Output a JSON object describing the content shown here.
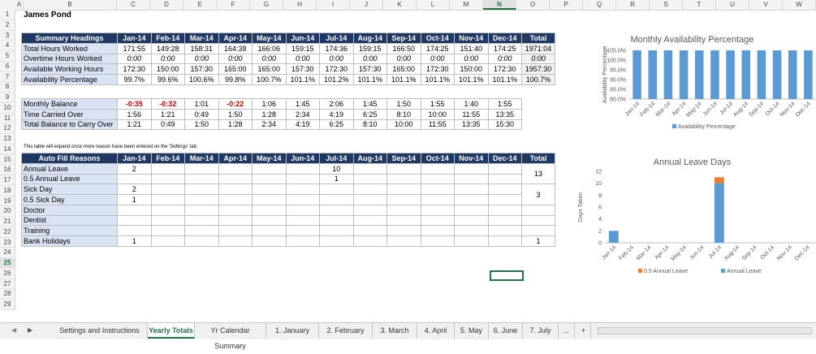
{
  "column_headers": [
    "A",
    "B",
    "C",
    "D",
    "E",
    "F",
    "G",
    "H",
    "I",
    "J",
    "K",
    "L",
    "M",
    "N",
    "O",
    "P",
    "Q",
    "R",
    "S",
    "T",
    "U",
    "V",
    "W"
  ],
  "selected_column": "N",
  "row_numbers": [
    "1",
    "2",
    "3",
    "4",
    "5",
    "6",
    "7",
    "8",
    "9",
    "10",
    "11",
    "12",
    "13",
    "14",
    "15",
    "16",
    "17",
    "18",
    "19",
    "20",
    "21",
    "22",
    "23",
    "24",
    "25",
    "26",
    "27",
    "28",
    "29"
  ],
  "selected_row": "25",
  "sheet_title": "James Pond",
  "months": [
    "Jan-14",
    "Feb-14",
    "Mar-14",
    "Apr-14",
    "May-14",
    "Jun-14",
    "Jul-14",
    "Aug-14",
    "Sep-14",
    "Oct-14",
    "Nov-14",
    "Dec-14"
  ],
  "summary": {
    "header": "Summary Headings",
    "total_label": "Total",
    "rows": [
      {
        "label": "Total Hours Worked",
        "values": [
          "171:55",
          "149:28",
          "158:31",
          "164:38",
          "166:06",
          "159:15",
          "174:36",
          "159:15",
          "166:50",
          "174:25",
          "151:40",
          "174:25"
        ],
        "total": "1971:04"
      },
      {
        "label": "Overtime Hours Worked",
        "values": [
          "0:00",
          "0:00",
          "0:00",
          "0:00",
          "0:00",
          "0:00",
          "0:00",
          "0:00",
          "0:00",
          "0:00",
          "0:00",
          "0:00"
        ],
        "total": "0:00"
      },
      {
        "label": "Available Working Hours",
        "values": [
          "172:30",
          "150:00",
          "157:30",
          "165:00",
          "165:00",
          "157:30",
          "172:30",
          "157:30",
          "165:00",
          "172:30",
          "150:00",
          "172:30"
        ],
        "total": "1957:30"
      },
      {
        "label": "Availability Percentage",
        "values": [
          "99.7%",
          "99.6%",
          "100.6%",
          "99.8%",
          "100.7%",
          "101.1%",
          "101.2%",
          "101.1%",
          "101.1%",
          "101.1%",
          "101.1%",
          "101.1%"
        ],
        "total": "100.7%"
      }
    ]
  },
  "balance": {
    "rows": [
      {
        "label": "Monthly Balance",
        "values": [
          "-0:35",
          "-0:32",
          "1:01",
          "-0:22",
          "1:06",
          "1:45",
          "2:06",
          "1:45",
          "1:50",
          "1:55",
          "1:40",
          "1:55"
        ]
      },
      {
        "label": "Time Carried Over",
        "values": [
          "1:56",
          "1:21",
          "0:49",
          "1:50",
          "1:28",
          "2:34",
          "4:19",
          "6:25",
          "8:10",
          "10:00",
          "11:55",
          "13:35"
        ]
      },
      {
        "label": "Total Balance to Carry Over",
        "values": [
          "1:21",
          "0:49",
          "1:50",
          "1:28",
          "2:34",
          "4:19",
          "6:25",
          "8:10",
          "10:00",
          "11:55",
          "13:35",
          "15:30"
        ]
      }
    ]
  },
  "note": "This table will expand once more reason have been entered on the 'Settings' tab.",
  "reasons": {
    "header": "Auto Fill Reasons",
    "total_label": "Total",
    "rows": [
      {
        "label": "Annual Leave",
        "values": [
          "2",
          "",
          "",
          "",
          "",
          "",
          "10",
          "",
          "",
          "",
          "",
          ""
        ]
      },
      {
        "label": "0.5 Annual Leave",
        "values": [
          "",
          "",
          "",
          "",
          "",
          "",
          "1",
          "",
          "",
          "",
          "",
          ""
        ]
      },
      {
        "label": "Sick Day",
        "values": [
          "2",
          "",
          "",
          "",
          "",
          "",
          "",
          "",
          "",
          "",
          "",
          ""
        ]
      },
      {
        "label": "0.5 Sick Day",
        "values": [
          "1",
          "",
          "",
          "",
          "",
          "",
          "",
          "",
          "",
          "",
          "",
          ""
        ]
      },
      {
        "label": "Doctor",
        "values": [
          "",
          "",
          "",
          "",
          "",
          "",
          "",
          "",
          "",
          "",
          "",
          ""
        ]
      },
      {
        "label": "Dentist",
        "values": [
          "",
          "",
          "",
          "",
          "",
          "",
          "",
          "",
          "",
          "",
          "",
          ""
        ]
      },
      {
        "label": "Training",
        "values": [
          "",
          "",
          "",
          "",
          "",
          "",
          "",
          "",
          "",
          "",
          "",
          ""
        ]
      },
      {
        "label": "Bank Holidays",
        "values": [
          "1",
          "",
          "",
          "",
          "",
          "",
          "",
          "",
          "",
          "",
          "",
          ""
        ]
      }
    ],
    "totals": {
      "annual": "13",
      "sick": "3",
      "bank": "1"
    }
  },
  "chart_data": [
    {
      "type": "bar",
      "title": "Monthly Availability Percentage",
      "ylabel": "Availability Percentage",
      "categories": [
        "Jan-14",
        "Feb-14",
        "Mar-14",
        "Apr-14",
        "May-14",
        "Jun-14",
        "Jul-14",
        "Aug-14",
        "Sep-14",
        "Oct-14",
        "Nov-14",
        "Dec-14"
      ],
      "series": [
        {
          "name": "Availability Percentage",
          "values": [
            99.7,
            99.6,
            100.6,
            99.8,
            100.7,
            101.1,
            101.2,
            101.1,
            101.1,
            101.1,
            101.1,
            101.1
          ],
          "color": "#5b9bd5"
        }
      ],
      "ylim": [
        80,
        105
      ],
      "yticks": [
        "80.0%",
        "85.0%",
        "90.0%",
        "95.0%",
        "100.0%",
        "105.0%"
      ],
      "legend": "bottom",
      "grid": false
    },
    {
      "type": "bar",
      "stacked": true,
      "title": "Annual Leave Days",
      "ylabel": "Days Taken",
      "categories": [
        "Jan-14",
        "Feb-14",
        "Mar-14",
        "Apr-14",
        "May-14",
        "Jun-14",
        "Jul-14",
        "Aug-14",
        "Sep-14",
        "Oct-14",
        "Nov-14",
        "Dec-14"
      ],
      "series": [
        {
          "name": "Annual Leave",
          "values": [
            2,
            0,
            0,
            0,
            0,
            0,
            10,
            0,
            0,
            0,
            0,
            0
          ],
          "color": "#5b9bd5"
        },
        {
          "name": "0.5 Annual Leave",
          "values": [
            0,
            0,
            0,
            0,
            0,
            0,
            1,
            0,
            0,
            0,
            0,
            0
          ],
          "color": "#ed7d31"
        }
      ],
      "ylim": [
        0,
        12
      ],
      "yticks": [
        "0",
        "2",
        "4",
        "6",
        "8",
        "10",
        "12"
      ],
      "legend": "bottom",
      "grid": false
    }
  ],
  "sheet_tabs": [
    "Settings and Instructions",
    "Yearly Totals",
    "Yr Calendar Summary",
    "1. January",
    "2. February",
    "3. March",
    "4. April",
    "5. May",
    "6. June",
    "7. July"
  ],
  "active_tab": "Yearly Totals",
  "tab_more": "...",
  "tab_add": "+",
  "nav_icons": [
    "nav-left-icon",
    "nav-right-icon"
  ]
}
